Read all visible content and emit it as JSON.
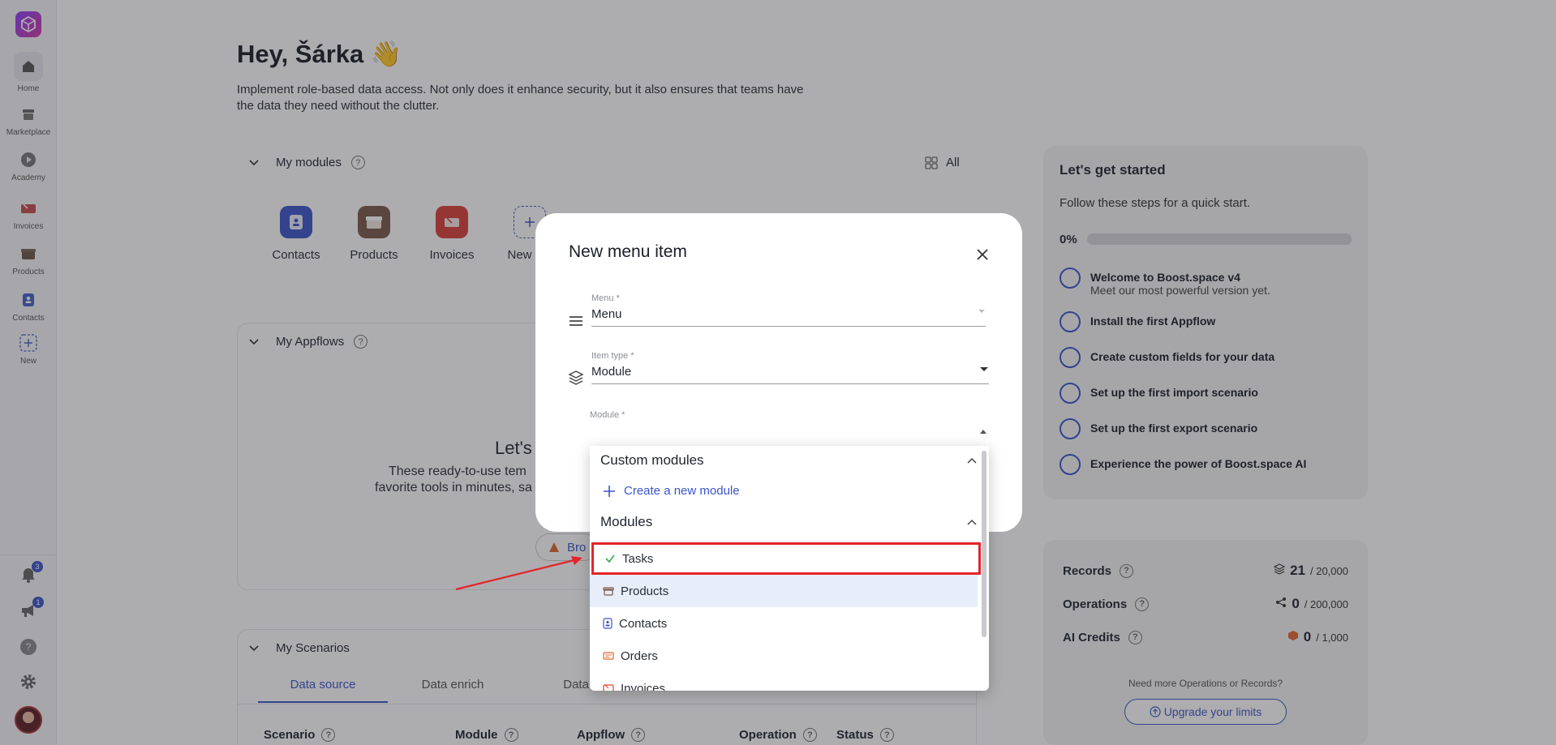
{
  "sidebar": {
    "items": [
      {
        "label": "Home",
        "icon": "home-icon"
      },
      {
        "label": "Marketplace",
        "icon": "store-icon"
      },
      {
        "label": "Academy",
        "icon": "play-icon"
      },
      {
        "label": "Invoices",
        "icon": "invoice-icon"
      },
      {
        "label": "Products",
        "icon": "box-icon"
      },
      {
        "label": "Contacts",
        "icon": "contact-icon"
      },
      {
        "label": "New",
        "icon": "plus-icon"
      }
    ],
    "notifications_count": "3",
    "announcements_count": "1"
  },
  "main": {
    "greeting": "Hey, Šárka 👋",
    "intro": "Implement role-based data access. Not only does it enhance security, but it also ensures that teams have the data they need without the clutter.",
    "my_modules": {
      "title": "My modules",
      "all_label": "All",
      "tiles": [
        {
          "label": "Contacts",
          "color": "#3a55c9"
        },
        {
          "label": "Products",
          "color": "#7a5a4a"
        },
        {
          "label": "Invoices",
          "color": "#d9403a"
        },
        {
          "label": "New mo",
          "color": "#3a55c9"
        }
      ]
    },
    "my_appflows": {
      "title": "My Appflows",
      "headline": "Let's",
      "desc_line1": "These ready-to-use tem",
      "desc_line2": "favorite tools in minutes, sa",
      "browse_label": "Bro"
    },
    "my_scenarios": {
      "title": "My Scenarios",
      "tabs": [
        "Data source",
        "Data enrich",
        "Data st"
      ],
      "columns": [
        "Scenario",
        "Module",
        "Appflow",
        "Operation",
        "Status"
      ]
    }
  },
  "getting_started": {
    "title": "Let's get started",
    "subtitle": "Follow these steps for a quick start.",
    "progress_label": "0%",
    "progress": 0,
    "steps": [
      {
        "title": "Welcome to Boost.space v4",
        "desc": "Meet our most powerful version yet."
      },
      {
        "title": "Install the first Appflow",
        "desc": ""
      },
      {
        "title": "Create custom fields for your data",
        "desc": ""
      },
      {
        "title": "Set up the first import scenario",
        "desc": ""
      },
      {
        "title": "Set up the first export scenario",
        "desc": ""
      },
      {
        "title": "Experience the power of Boost.space AI",
        "desc": ""
      }
    ]
  },
  "stats": {
    "records": {
      "label": "Records",
      "value": "21",
      "limit": "/ 20,000"
    },
    "operations": {
      "label": "Operations",
      "value": "0",
      "limit": "/ 200,000"
    },
    "ai_credits": {
      "label": "AI Credits",
      "value": "0",
      "limit": "/ 1,000"
    },
    "need_more": "Need more Operations or Records?",
    "upgrade_label": "Upgrade your limits"
  },
  "modal": {
    "title": "New menu item",
    "menu_label": "Menu *",
    "menu_value": "Menu",
    "item_type_label": "Item type *",
    "item_type_value": "Module",
    "module_label": "Module *"
  },
  "dropdown": {
    "group_custom": "Custom modules",
    "create_label": "Create a new module",
    "group_modules": "Modules",
    "items": [
      {
        "label": "Tasks",
        "icon": "check-icon"
      },
      {
        "label": "Products",
        "icon": "box-icon"
      },
      {
        "label": "Contacts",
        "icon": "contact-icon"
      },
      {
        "label": "Orders",
        "icon": "order-icon"
      },
      {
        "label": "Invoices",
        "icon": "invoice-icon"
      }
    ]
  },
  "colors": {
    "accent": "#3a55c9",
    "highlight": "#e3242b"
  }
}
